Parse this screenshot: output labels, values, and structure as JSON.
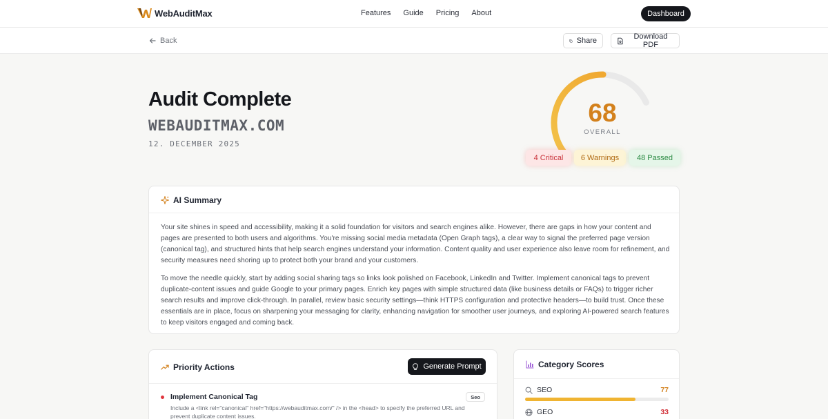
{
  "brand": {
    "name": "WebAuditMax"
  },
  "nav": {
    "features": "Features",
    "guide": "Guide",
    "pricing": "Pricing",
    "about": "About",
    "dashboard": "Dashboard"
  },
  "toolbar": {
    "back": "Back",
    "share": "Share",
    "download": "Download PDF"
  },
  "hero": {
    "title": "Audit Complete",
    "domain": "WEBAUDITMAX.COM",
    "date": "12. DECEMBER 2025"
  },
  "score": {
    "value": 68,
    "max": 100,
    "label": "OVERALL",
    "color": "#d3811c"
  },
  "pills": {
    "critical": "4 Critical",
    "warnings": "6 Warnings",
    "passed": "48 Passed"
  },
  "summary": {
    "title": "AI Summary",
    "p1": "Your site shines in speed and accessibility, making it a solid foundation for visitors and search engines alike. However, there are gaps in how your content and pages are presented to both users and algorithms. You're missing social media metadata (Open Graph tags), a clear way to signal the preferred page version (canonical tag), and structured hints that help search engines understand your information. Content quality and user experience also leave room for refinement, and security measures need shoring up to protect both your brand and your customers.",
    "p2": "To move the needle quickly, start by adding social sharing tags so links look polished on Facebook, LinkedIn and Twitter. Implement canonical tags to prevent duplicate-content issues and guide Google to your primary pages. Enrich key pages with simple structured data (like business details or FAQs) to trigger richer search results and improve click-through. In parallel, review basic security settings—think HTTPS configuration and protective headers—to build trust. Once these essentials are in place, focus on sharpening your messaging for clarity, enhancing navigation for smoother user journeys, and exploring AI-powered search features to keep visitors engaged and coming back."
  },
  "actions": {
    "title": "Priority Actions",
    "generate": "Generate Prompt",
    "items": [
      {
        "title": "Implement Canonical Tag",
        "desc": "Include a <link rel=\"canonical\" href=\"https://webauditmax.com/\" /> in the <head> to specify the preferred URL and prevent duplicate content issues.",
        "tag": "Seo"
      }
    ]
  },
  "categories": {
    "title": "Category Scores",
    "items": [
      {
        "name": "SEO",
        "score": 77,
        "color": "#d3811c",
        "bar": "#f0b432"
      },
      {
        "name": "GEO",
        "score": 33,
        "color": "#d02b33",
        "bar": "#e0353d"
      }
    ]
  }
}
